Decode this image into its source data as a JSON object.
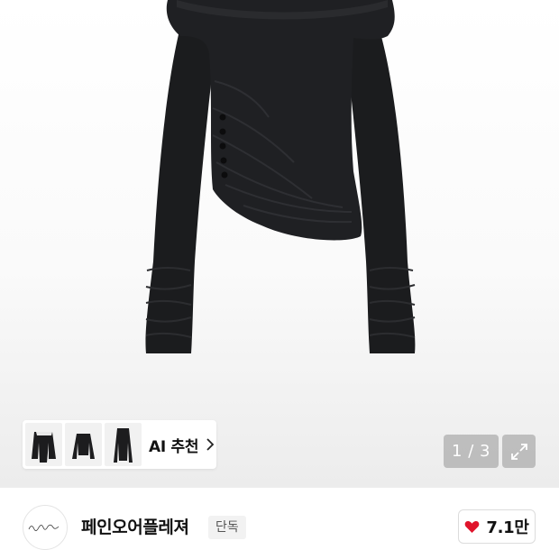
{
  "hero": {
    "image_alt": "black long-sleeve off-shoulder ruched top with buttons",
    "ai_recommend": {
      "label": "AI 추천",
      "thumbnails": [
        "off-shoulder-top-thumb",
        "black-long-sleeve-top-thumb",
        "black-fitted-top-thumb"
      ]
    },
    "page_indicator": "1 / 3",
    "expand_icon": "expand-arrows-icon"
  },
  "brand": {
    "logo_text": "Pain ou plaisance",
    "name": "페인오어플레져",
    "badge": "단독",
    "like_count": "7.1만",
    "like_icon": "heart-icon",
    "accent_color": "#e0142b"
  }
}
